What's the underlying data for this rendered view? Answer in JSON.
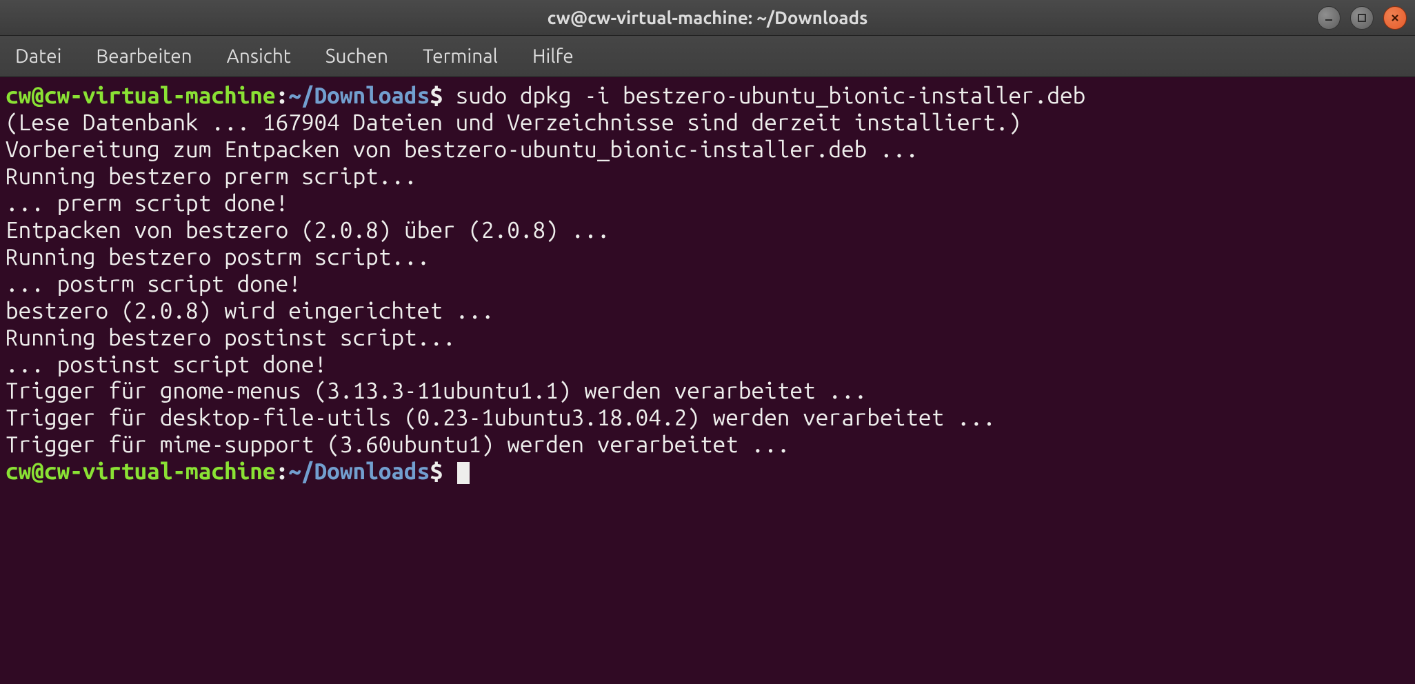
{
  "window": {
    "title": "cw@cw-virtual-machine: ~/Downloads"
  },
  "menubar": {
    "items": [
      "Datei",
      "Bearbeiten",
      "Ansicht",
      "Suchen",
      "Terminal",
      "Hilfe"
    ]
  },
  "prompt": {
    "user_host": "cw@cw-virtual-machine",
    "colon": ":",
    "path": "~/Downloads",
    "symbol": "$"
  },
  "command1": " sudo dpkg -i bestzero-ubuntu_bionic-installer.deb",
  "output_lines": [
    "(Lese Datenbank ... 167904 Dateien und Verzeichnisse sind derzeit installiert.)",
    "Vorbereitung zum Entpacken von bestzero-ubuntu_bionic-installer.deb ...",
    "Running bestzero prerm script...",
    "... prerm script done!",
    "Entpacken von bestzero (2.0.8) über (2.0.8) ...",
    "Running bestzero postrm script...",
    "... postrm script done!",
    "bestzero (2.0.8) wird eingerichtet ...",
    "Running bestzero postinst script...",
    "... postinst script done!",
    "Trigger für gnome-menus (3.13.3-11ubuntu1.1) werden verarbeitet ...",
    "Trigger für desktop-file-utils (0.23-1ubuntu3.18.04.2) werden verarbeitet ...",
    "Trigger für mime-support (3.60ubuntu1) werden verarbeitet ..."
  ],
  "command2": " "
}
